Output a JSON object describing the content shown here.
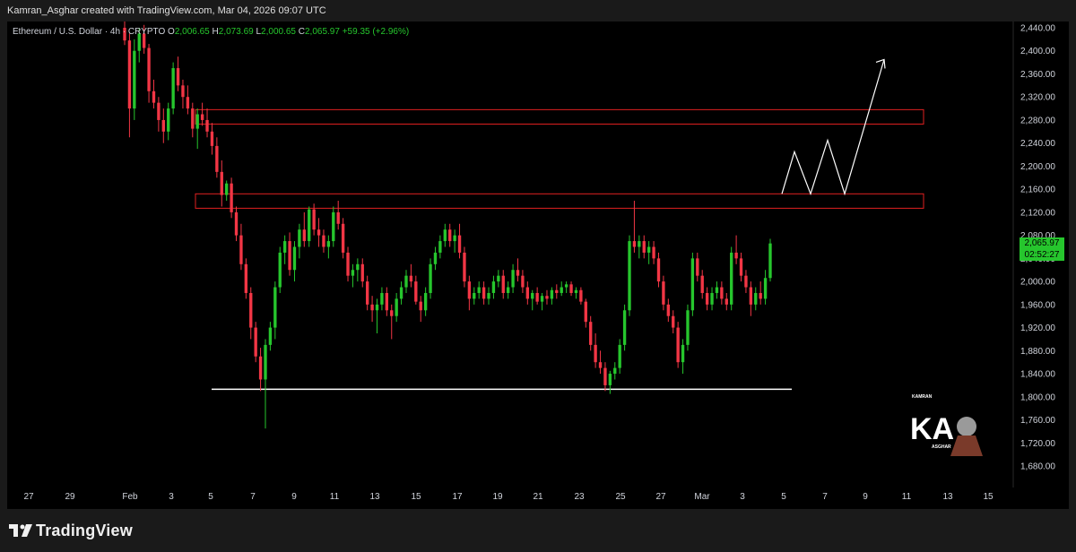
{
  "header": {
    "attribution": "Kamran_Asghar created with TradingView.com, Mar 04, 2026 09:07 UTC"
  },
  "legend": {
    "symbol": "Ethereum / U.S. Dollar · 4h · CRYPTO",
    "open_label": "O",
    "open": "2,006.65",
    "high_label": "H",
    "high": "2,073.69",
    "low_label": "L",
    "low": "2,000.65",
    "close_label": "C",
    "close": "2,065.97",
    "change": "+59.35 (+2.96%)"
  },
  "price_tag": {
    "price": "2,065.97",
    "countdown": "02:52:27"
  },
  "footer": {
    "brand": "TradingView"
  },
  "watermark": {
    "text_top": "KAMRAN",
    "text_bottom": "ASGHAR",
    "monogram": "KA"
  },
  "colors": {
    "up": "#26c62d",
    "down": "#f23645",
    "zone_border": "#e02020",
    "projection": "#ffffff",
    "background": "#000000"
  },
  "chart_data": {
    "type": "candlestick",
    "title": "Ethereum / U.S. Dollar · 4h · CRYPTO",
    "xlabel": "",
    "ylabel": "",
    "ylim": [
      1640,
      2460
    ],
    "y_ticks": [
      "2,440.00",
      "2,400.00",
      "2,360.00",
      "2,320.00",
      "2,280.00",
      "2,240.00",
      "2,200.00",
      "2,160.00",
      "2,120.00",
      "2,080.00",
      "2,040.00",
      "2,000.00",
      "1,960.00",
      "1,920.00",
      "1,880.00",
      "1,840.00",
      "1,800.00",
      "1,760.00",
      "1,720.00",
      "1,680.00"
    ],
    "x_ticks": [
      "27",
      "29",
      "Feb",
      "3",
      "5",
      "7",
      "9",
      "11",
      "13",
      "15",
      "17",
      "19",
      "21",
      "23",
      "25",
      "27",
      "Mar",
      "3",
      "5",
      "7",
      "9",
      "11",
      "13",
      "15"
    ],
    "grid": false,
    "zones": [
      {
        "name": "upper resistance zone",
        "low": 2273,
        "high": 2298
      },
      {
        "name": "lower resistance zone",
        "low": 2127,
        "high": 2152
      }
    ],
    "support_level": 1813,
    "projection_path": [
      2152,
      2225,
      2152,
      2245,
      2152,
      2385
    ],
    "candles": [
      [
        2440,
        2460,
        2410,
        2418
      ],
      [
        2418,
        2430,
        2250,
        2300
      ],
      [
        2300,
        2420,
        2280,
        2400
      ],
      [
        2400,
        2440,
        2380,
        2430
      ],
      [
        2430,
        2445,
        2395,
        2405
      ],
      [
        2405,
        2412,
        2310,
        2330
      ],
      [
        2330,
        2350,
        2300,
        2310
      ],
      [
        2310,
        2320,
        2260,
        2280
      ],
      [
        2280,
        2300,
        2240,
        2260
      ],
      [
        2260,
        2310,
        2245,
        2300
      ],
      [
        2300,
        2380,
        2290,
        2370
      ],
      [
        2370,
        2390,
        2330,
        2340
      ],
      [
        2340,
        2350,
        2300,
        2320
      ],
      [
        2320,
        2340,
        2290,
        2300
      ],
      [
        2300,
        2310,
        2250,
        2265
      ],
      [
        2265,
        2300,
        2230,
        2290
      ],
      [
        2290,
        2310,
        2270,
        2280
      ],
      [
        2280,
        2300,
        2250,
        2260
      ],
      [
        2260,
        2275,
        2220,
        2235
      ],
      [
        2235,
        2250,
        2180,
        2190
      ],
      [
        2190,
        2210,
        2130,
        2150
      ],
      [
        2150,
        2175,
        2140,
        2170
      ],
      [
        2170,
        2180,
        2110,
        2120
      ],
      [
        2120,
        2130,
        2070,
        2080
      ],
      [
        2080,
        2100,
        2020,
        2030
      ],
      [
        2030,
        2040,
        1970,
        1980
      ],
      [
        1980,
        1990,
        1900,
        1920
      ],
      [
        1920,
        1930,
        1860,
        1870
      ],
      [
        1870,
        1885,
        1810,
        1830
      ],
      [
        1830,
        1900,
        1745,
        1890
      ],
      [
        1890,
        1930,
        1880,
        1920
      ],
      [
        1920,
        2000,
        1900,
        1990
      ],
      [
        1990,
        2060,
        1980,
        2050
      ],
      [
        2050,
        2080,
        2030,
        2070
      ],
      [
        2070,
        2085,
        2010,
        2020
      ],
      [
        2020,
        2070,
        2000,
        2060
      ],
      [
        2060,
        2100,
        2040,
        2090
      ],
      [
        2090,
        2120,
        2060,
        2070
      ],
      [
        2070,
        2130,
        2060,
        2125
      ],
      [
        2125,
        2135,
        2080,
        2090
      ],
      [
        2090,
        2110,
        2060,
        2080
      ],
      [
        2080,
        2090,
        2050,
        2060
      ],
      [
        2060,
        2080,
        2040,
        2070
      ],
      [
        2070,
        2130,
        2060,
        2120
      ],
      [
        2120,
        2140,
        2090,
        2100
      ],
      [
        2100,
        2110,
        2040,
        2050
      ],
      [
        2050,
        2060,
        2000,
        2010
      ],
      [
        2010,
        2030,
        1990,
        2020
      ],
      [
        2020,
        2040,
        2000,
        2030
      ],
      [
        2030,
        2040,
        1990,
        2000
      ],
      [
        2000,
        2010,
        1950,
        1960
      ],
      [
        1960,
        1975,
        1930,
        1950
      ],
      [
        1950,
        1970,
        1910,
        1960
      ],
      [
        1960,
        1990,
        1950,
        1980
      ],
      [
        1980,
        1990,
        1940,
        1950
      ],
      [
        1950,
        1960,
        1900,
        1940
      ],
      [
        1940,
        1980,
        1930,
        1970
      ],
      [
        1970,
        2000,
        1960,
        1990
      ],
      [
        1990,
        2020,
        1980,
        2010
      ],
      [
        2010,
        2030,
        1990,
        2000
      ],
      [
        2000,
        2010,
        1960,
        1965
      ],
      [
        1965,
        1975,
        1930,
        1950
      ],
      [
        1950,
        1990,
        1940,
        1980
      ],
      [
        1980,
        2040,
        1970,
        2030
      ],
      [
        2030,
        2060,
        2020,
        2050
      ],
      [
        2050,
        2080,
        2040,
        2070
      ],
      [
        2070,
        2100,
        2060,
        2090
      ],
      [
        2090,
        2100,
        2060,
        2070
      ],
      [
        2070,
        2090,
        2050,
        2080
      ],
      [
        2080,
        2100,
        2040,
        2050
      ],
      [
        2050,
        2060,
        1990,
        2000
      ],
      [
        2000,
        2010,
        1950,
        1970
      ],
      [
        1970,
        1990,
        1960,
        1980
      ],
      [
        1980,
        2000,
        1970,
        1990
      ],
      [
        1990,
        2000,
        1960,
        1970
      ],
      [
        1970,
        1990,
        1960,
        1980
      ],
      [
        1980,
        2010,
        1970,
        2000
      ],
      [
        2000,
        2020,
        1990,
        2010
      ],
      [
        2010,
        2020,
        1970,
        1980
      ],
      [
        1980,
        2000,
        1970,
        1990
      ],
      [
        1990,
        2030,
        1980,
        2020
      ],
      [
        2020,
        2040,
        2000,
        2010
      ],
      [
        2010,
        2020,
        1980,
        1990
      ],
      [
        1990,
        2000,
        1960,
        1970
      ],
      [
        1970,
        1985,
        1950,
        1980
      ],
      [
        1980,
        1990,
        1960,
        1965
      ],
      [
        1965,
        1980,
        1950,
        1975
      ],
      [
        1975,
        1985,
        1960,
        1970
      ],
      [
        1970,
        1990,
        1960,
        1985
      ],
      [
        1985,
        1995,
        1970,
        1980
      ],
      [
        1980,
        2000,
        1975,
        1990
      ],
      [
        1990,
        2000,
        1980,
        1995
      ],
      [
        1995,
        2000,
        1975,
        1980
      ],
      [
        1980,
        1990,
        1970,
        1985
      ],
      [
        1985,
        1990,
        1960,
        1965
      ],
      [
        1965,
        1970,
        1920,
        1930
      ],
      [
        1930,
        1940,
        1880,
        1890
      ],
      [
        1890,
        1910,
        1850,
        1860
      ],
      [
        1860,
        1880,
        1840,
        1850
      ],
      [
        1850,
        1860,
        1810,
        1820
      ],
      [
        1820,
        1845,
        1805,
        1840
      ],
      [
        1840,
        1860,
        1830,
        1850
      ],
      [
        1850,
        1900,
        1840,
        1890
      ],
      [
        1890,
        1960,
        1880,
        1950
      ],
      [
        1950,
        2080,
        1940,
        2070
      ],
      [
        2070,
        2140,
        2050,
        2060
      ],
      [
        2060,
        2080,
        2040,
        2070
      ],
      [
        2070,
        2080,
        2040,
        2050
      ],
      [
        2050,
        2070,
        2030,
        2060
      ],
      [
        2060,
        2070,
        2030,
        2040
      ],
      [
        2040,
        2050,
        1990,
        2000
      ],
      [
        2000,
        2010,
        1950,
        1960
      ],
      [
        1960,
        1970,
        1930,
        1940
      ],
      [
        1940,
        1950,
        1910,
        1920
      ],
      [
        1920,
        1930,
        1850,
        1860
      ],
      [
        1860,
        1900,
        1840,
        1890
      ],
      [
        1890,
        1960,
        1880,
        1950
      ],
      [
        1950,
        2050,
        1940,
        2040
      ],
      [
        2040,
        2050,
        2000,
        2010
      ],
      [
        2010,
        2020,
        1970,
        1980
      ],
      [
        1980,
        1990,
        1950,
        1960
      ],
      [
        1960,
        1990,
        1950,
        1980
      ],
      [
        1980,
        2000,
        1970,
        1990
      ],
      [
        1990,
        2000,
        1960,
        1970
      ],
      [
        1970,
        1980,
        1950,
        1960
      ],
      [
        1960,
        2060,
        1950,
        2050
      ],
      [
        2050,
        2080,
        2030,
        2040
      ],
      [
        2040,
        2050,
        2000,
        2010
      ],
      [
        2010,
        2020,
        1980,
        1990
      ],
      [
        1990,
        2000,
        1940,
        1960
      ],
      [
        1960,
        1990,
        1950,
        1980
      ],
      [
        1980,
        2000,
        1960,
        1970
      ],
      [
        1970,
        2020,
        1960,
        2006
      ],
      [
        2006,
        2074,
        2000,
        2066
      ]
    ]
  }
}
